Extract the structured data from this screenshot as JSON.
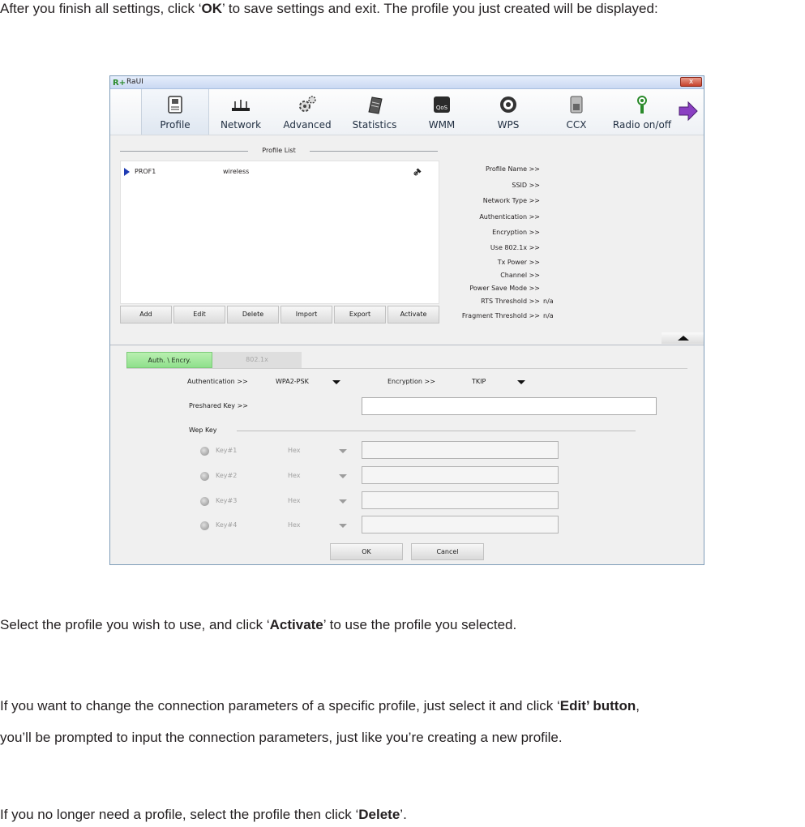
{
  "paragraphs": {
    "p1_a": "After you finish all settings, click ‘",
    "p1_b": "OK",
    "p1_c": "’ to save settings and exit. The profile you just created will be displayed:",
    "p2_a": "Select the profile you wish to use, and click ‘",
    "p2_b": "Activate",
    "p2_c": "’ to use the profile you selected.",
    "p3_a": "If you want to change the connection parameters of a specific profile, just select it and click ‘",
    "p3_b": "Edit’ button",
    "p3_c": ",",
    "p4": "you’ll be prompted to input the connection parameters, just like you’re creating a new profile.",
    "p5_a": "If you no longer need a profile, select the profile then click ‘",
    "p5_b": "Delete",
    "p5_c": "’."
  },
  "window": {
    "title": "RaUI",
    "close_label": "x",
    "toolbar": [
      {
        "label": "Profile",
        "icon": "profile-icon"
      },
      {
        "label": "Network",
        "icon": "network-icon"
      },
      {
        "label": "Advanced",
        "icon": "advanced-gears-icon"
      },
      {
        "label": "Statistics",
        "icon": "statistics-icon"
      },
      {
        "label": "WMM",
        "icon": "wmm-qos-icon"
      },
      {
        "label": "WPS",
        "icon": "wps-icon"
      },
      {
        "label": "CCX",
        "icon": "ccx-icon"
      },
      {
        "label": "Radio on/off",
        "icon": "radio-antenna-icon"
      }
    ],
    "next_icon": "arrow-right-icon",
    "profile_list": {
      "heading": "Profile List",
      "rows": [
        {
          "name": "PROF1",
          "type": "wireless"
        }
      ],
      "buttons": [
        "Add",
        "Edit",
        "Delete",
        "Import",
        "Export",
        "Activate"
      ]
    },
    "info": [
      {
        "label": "Profile Name >>",
        "value": ""
      },
      {
        "label": "SSID >>",
        "value": ""
      },
      {
        "label": "Network Type >>",
        "value": ""
      },
      {
        "label": "Authentication >>",
        "value": ""
      },
      {
        "label": "Encryption >>",
        "value": ""
      },
      {
        "label": "Use 802.1x >>",
        "value": ""
      },
      {
        "label": "Tx Power >>",
        "value": ""
      },
      {
        "label": "Channel >>",
        "value": ""
      },
      {
        "label": "Power Save Mode >>",
        "value": ""
      },
      {
        "label": "RTS Threshold >>",
        "value": "n/a"
      },
      {
        "label": "Fragment Threshold >>",
        "value": "n/a"
      }
    ],
    "tabs": [
      "Auth. \\ Encry.",
      "802.1x"
    ],
    "auth": {
      "auth_label": "Authentication >>",
      "auth_value": "WPA2-PSK",
      "enc_label": "Encryption >>",
      "enc_value": "TKIP",
      "psk_label": "Preshared Key >>",
      "psk_value": "",
      "wep_heading": "Wep Key",
      "keys": [
        {
          "label": "Key#1",
          "format": "Hex"
        },
        {
          "label": "Key#2",
          "format": "Hex"
        },
        {
          "label": "Key#3",
          "format": "Hex"
        },
        {
          "label": "Key#4",
          "format": "Hex"
        }
      ]
    },
    "ok_label": "OK",
    "cancel_label": "Cancel"
  }
}
